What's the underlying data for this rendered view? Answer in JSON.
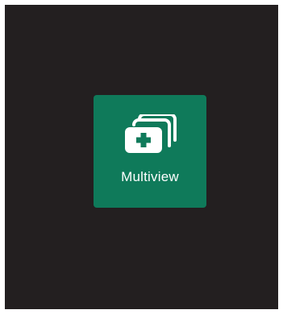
{
  "tile": {
    "label": "Multiview",
    "icon": "multiview-stack-plus-icon",
    "color": "#0f7a5a"
  },
  "colors": {
    "background": "#231f20",
    "icon": "#ffffff"
  }
}
